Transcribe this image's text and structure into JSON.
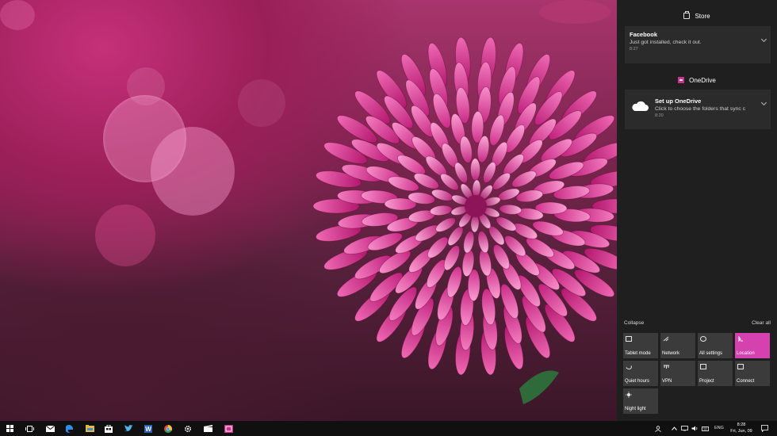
{
  "action_center": {
    "groups": [
      {
        "app": "Store",
        "icon": "store-icon",
        "notification": {
          "title": "Facebook",
          "body": "Just got installed, check it out.",
          "time": "8:27"
        }
      },
      {
        "app": "OneDrive",
        "icon": "onedrive-icon",
        "notification": {
          "title": "Set up OneDrive",
          "body": "Click to choose the folders that sync c",
          "time": "8:20"
        }
      }
    ],
    "collapse_label": "Collapse",
    "clear_all_label": "Clear all",
    "quick_actions": [
      {
        "label": "Tablet mode",
        "icon": "tablet-mode-icon",
        "active": false
      },
      {
        "label": "Network",
        "icon": "network-icon",
        "active": false
      },
      {
        "label": "All settings",
        "icon": "gear-icon",
        "active": false
      },
      {
        "label": "Location",
        "icon": "location-icon",
        "active": true
      },
      {
        "label": "Quiet hours",
        "icon": "moon-icon",
        "active": false
      },
      {
        "label": "VPN",
        "icon": "vpn-icon",
        "active": false
      },
      {
        "label": "Project",
        "icon": "project-icon",
        "active": false
      },
      {
        "label": "Connect",
        "icon": "connect-icon",
        "active": false
      },
      {
        "label": "Night light",
        "icon": "brightness-icon",
        "active": false
      }
    ]
  },
  "taskbar": {
    "pinned": [
      "start-icon",
      "task-view-icon",
      "mail-icon",
      "edge-icon",
      "file-explorer-icon",
      "store-icon",
      "twitter-icon",
      "word-icon",
      "chrome-icon",
      "settings-icon",
      "movies-icon",
      "app-icon"
    ],
    "tray": {
      "language": "ENG",
      "time": "8:28",
      "date": "Fri, Jun, 09"
    }
  },
  "colors": {
    "accent": "#d641b0",
    "action_center_bg": "#1f1f1f",
    "tile_bg": "#3b3b3b",
    "taskbar_bg": "#101010"
  }
}
